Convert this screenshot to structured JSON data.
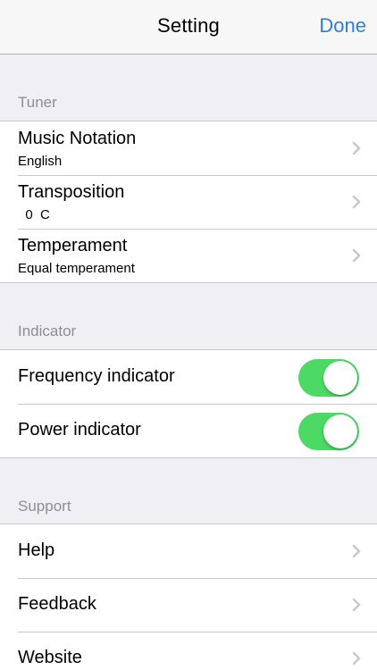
{
  "navbar": {
    "title": "Setting",
    "done_label": "Done"
  },
  "sections": {
    "tuner": {
      "header": "Tuner",
      "items": [
        {
          "title": "Music Notation",
          "subtitle": "English"
        },
        {
          "title": "Transposition",
          "subtitle": "  0  C"
        },
        {
          "title": "Temperament",
          "subtitle": "Equal temperament"
        }
      ]
    },
    "indicator": {
      "header": "Indicator",
      "items": [
        {
          "title": "Frequency indicator",
          "enabled": true
        },
        {
          "title": "Power indicator",
          "enabled": true
        }
      ]
    },
    "support": {
      "header": "Support",
      "items": [
        {
          "title": "Help"
        },
        {
          "title": "Feedback"
        },
        {
          "title": "Website"
        }
      ]
    }
  },
  "icons": {
    "chevron": "chevron-right-icon"
  },
  "colors": {
    "accent": "#2a7fd8",
    "toggle_on": "#4cd964",
    "background": "#efeff4",
    "section_header": "#8e8e93"
  }
}
